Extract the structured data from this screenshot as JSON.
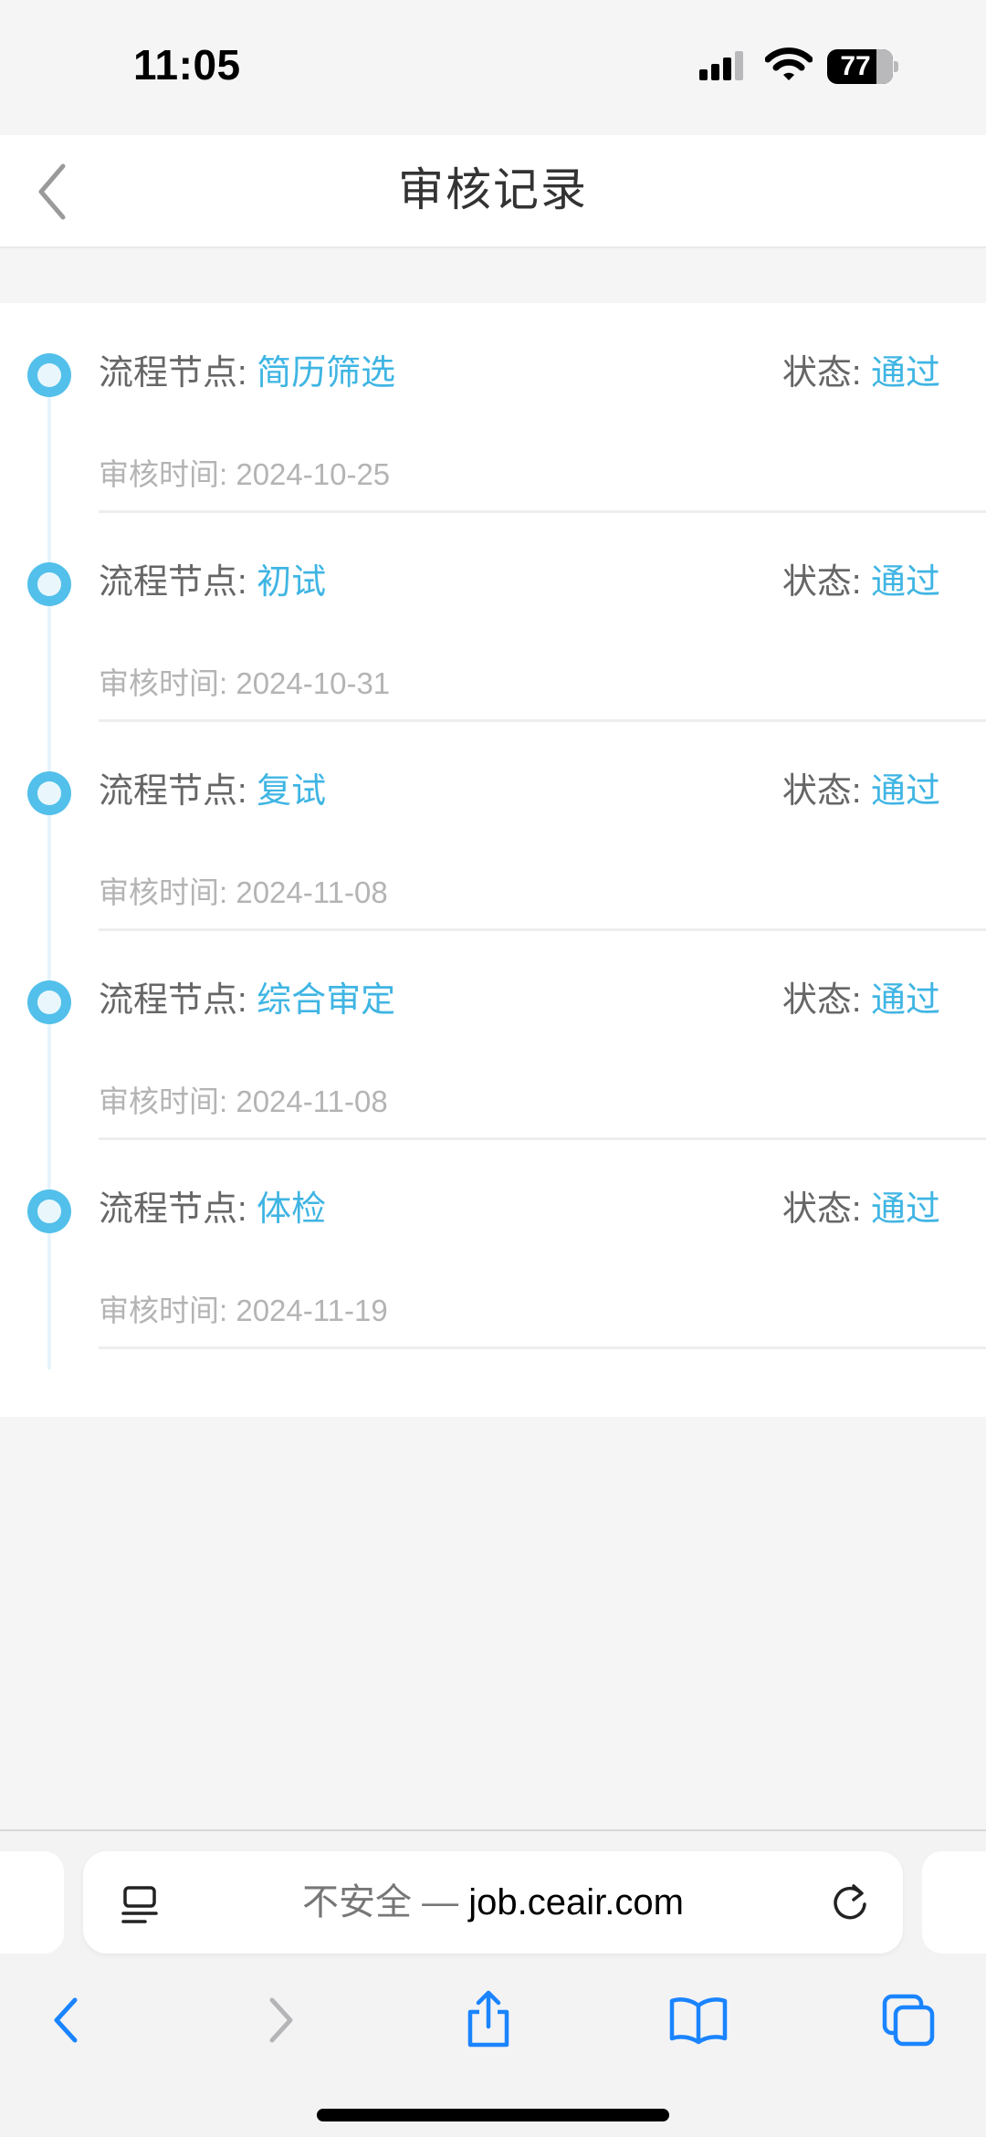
{
  "status_bar": {
    "time": "11:05",
    "battery": "77"
  },
  "header": {
    "title": "审核记录"
  },
  "records": [
    {
      "node_label": "流程节点: ",
      "node": "简历筛选",
      "status_label": "状态: ",
      "status": "通过",
      "time_label": "审核时间: ",
      "time": "2024-10-25"
    },
    {
      "node_label": "流程节点: ",
      "node": "初试",
      "status_label": "状态: ",
      "status": "通过",
      "time_label": "审核时间: ",
      "time": "2024-10-31"
    },
    {
      "node_label": "流程节点: ",
      "node": "复试",
      "status_label": "状态: ",
      "status": "通过",
      "time_label": "审核时间: ",
      "time": "2024-11-08"
    },
    {
      "node_label": "流程节点: ",
      "node": "综合审定",
      "status_label": "状态: ",
      "status": "通过",
      "time_label": "审核时间: ",
      "time": "2024-11-08"
    },
    {
      "node_label": "流程节点: ",
      "node": "体检",
      "status_label": "状态: ",
      "status": "通过",
      "time_label": "审核时间: ",
      "time": "2024-11-19"
    }
  ],
  "browser": {
    "security": "不安全 — ",
    "domain": "job.ceair.com"
  },
  "colors": {
    "accent": "#3fb5e3",
    "ios_blue": "#1a84ff",
    "label": "#666666",
    "muted": "#b4b4b4"
  },
  "icons": [
    "back-chevron-icon",
    "reader-icon",
    "reload-icon",
    "back-icon",
    "forward-icon",
    "share-icon",
    "bookmarks-icon",
    "tabs-icon"
  ]
}
